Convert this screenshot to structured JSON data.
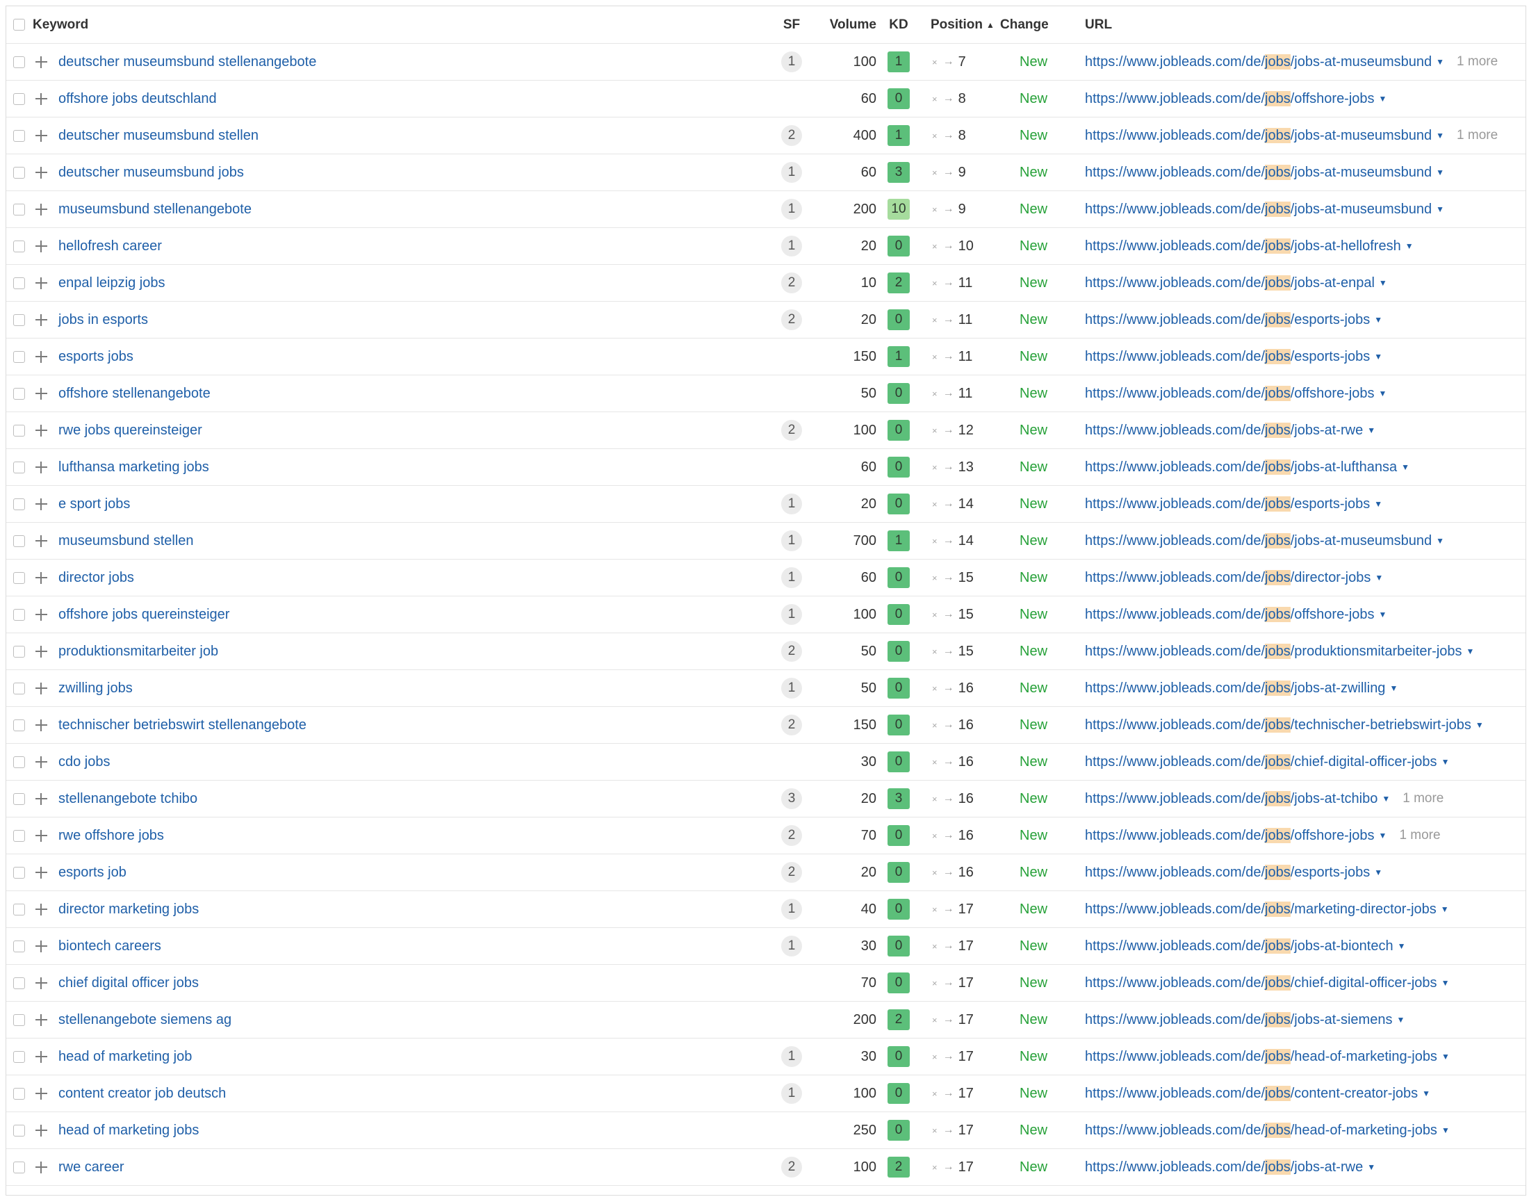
{
  "header": {
    "keyword": "Keyword",
    "sf": "SF",
    "volume": "Volume",
    "kd": "KD",
    "position": "Position",
    "change": "Change",
    "url": "URL"
  },
  "url_prefix": "https://www.jobleads.com/de/",
  "url_highlight": "jobs",
  "rows": [
    {
      "keyword": "deutscher museumsbund stellenangebote",
      "sf": "1",
      "volume": "100",
      "kd": "1",
      "position": "7",
      "change": "New",
      "url_slug": "jobs-at-museumsbund",
      "more": "1 more"
    },
    {
      "keyword": "offshore jobs deutschland",
      "sf": "",
      "volume": "60",
      "kd": "0",
      "position": "8",
      "change": "New",
      "url_slug": "offshore-jobs",
      "more": ""
    },
    {
      "keyword": "deutscher museumsbund stellen",
      "sf": "2",
      "volume": "400",
      "kd": "1",
      "position": "8",
      "change": "New",
      "url_slug": "jobs-at-museumsbund",
      "more": "1 more"
    },
    {
      "keyword": "deutscher museumsbund jobs",
      "sf": "1",
      "volume": "60",
      "kd": "3",
      "position": "9",
      "change": "New",
      "url_slug": "jobs-at-museumsbund",
      "more": ""
    },
    {
      "keyword": "museumsbund stellenangebote",
      "sf": "1",
      "volume": "200",
      "kd": "10",
      "position": "9",
      "change": "New",
      "url_slug": "jobs-at-museumsbund",
      "more": ""
    },
    {
      "keyword": "hellofresh career",
      "sf": "1",
      "volume": "20",
      "kd": "0",
      "position": "10",
      "change": "New",
      "url_slug": "jobs-at-hellofresh",
      "more": ""
    },
    {
      "keyword": "enpal leipzig jobs",
      "sf": "2",
      "volume": "10",
      "kd": "2",
      "position": "11",
      "change": "New",
      "url_slug": "jobs-at-enpal",
      "more": ""
    },
    {
      "keyword": "jobs in esports",
      "sf": "2",
      "volume": "20",
      "kd": "0",
      "position": "11",
      "change": "New",
      "url_slug": "esports-jobs",
      "more": ""
    },
    {
      "keyword": "esports jobs",
      "sf": "",
      "volume": "150",
      "kd": "1",
      "position": "11",
      "change": "New",
      "url_slug": "esports-jobs",
      "more": ""
    },
    {
      "keyword": "offshore stellenangebote",
      "sf": "",
      "volume": "50",
      "kd": "0",
      "position": "11",
      "change": "New",
      "url_slug": "offshore-jobs",
      "more": ""
    },
    {
      "keyword": "rwe jobs quereinsteiger",
      "sf": "2",
      "volume": "100",
      "kd": "0",
      "position": "12",
      "change": "New",
      "url_slug": "jobs-at-rwe",
      "more": ""
    },
    {
      "keyword": "lufthansa marketing jobs",
      "sf": "",
      "volume": "60",
      "kd": "0",
      "position": "13",
      "change": "New",
      "url_slug": "jobs-at-lufthansa",
      "more": ""
    },
    {
      "keyword": "e sport jobs",
      "sf": "1",
      "volume": "20",
      "kd": "0",
      "position": "14",
      "change": "New",
      "url_slug": "esports-jobs",
      "more": ""
    },
    {
      "keyword": "museumsbund stellen",
      "sf": "1",
      "volume": "700",
      "kd": "1",
      "position": "14",
      "change": "New",
      "url_slug": "jobs-at-museumsbund",
      "more": ""
    },
    {
      "keyword": "director jobs",
      "sf": "1",
      "volume": "60",
      "kd": "0",
      "position": "15",
      "change": "New",
      "url_slug": "director-jobs",
      "more": ""
    },
    {
      "keyword": "offshore jobs quereinsteiger",
      "sf": "1",
      "volume": "100",
      "kd": "0",
      "position": "15",
      "change": "New",
      "url_slug": "offshore-jobs",
      "more": ""
    },
    {
      "keyword": "produktionsmitarbeiter job",
      "sf": "2",
      "volume": "50",
      "kd": "0",
      "position": "15",
      "change": "New",
      "url_slug": "produktionsmitarbeiter-jobs",
      "more": ""
    },
    {
      "keyword": "zwilling jobs",
      "sf": "1",
      "volume": "50",
      "kd": "0",
      "position": "16",
      "change": "New",
      "url_slug": "jobs-at-zwilling",
      "more": ""
    },
    {
      "keyword": "technischer betriebswirt stellenangebote",
      "sf": "2",
      "volume": "150",
      "kd": "0",
      "position": "16",
      "change": "New",
      "url_slug": "technischer-betriebswirt-jobs",
      "more": ""
    },
    {
      "keyword": "cdo jobs",
      "sf": "",
      "volume": "30",
      "kd": "0",
      "position": "16",
      "change": "New",
      "url_slug": "chief-digital-officer-jobs",
      "more": ""
    },
    {
      "keyword": "stellenangebote tchibo",
      "sf": "3",
      "volume": "20",
      "kd": "3",
      "position": "16",
      "change": "New",
      "url_slug": "jobs-at-tchibo",
      "more": "1 more"
    },
    {
      "keyword": "rwe offshore jobs",
      "sf": "2",
      "volume": "70",
      "kd": "0",
      "position": "16",
      "change": "New",
      "url_slug": "offshore-jobs",
      "more": "1 more"
    },
    {
      "keyword": "esports job",
      "sf": "2",
      "volume": "20",
      "kd": "0",
      "position": "16",
      "change": "New",
      "url_slug": "esports-jobs",
      "more": ""
    },
    {
      "keyword": "director marketing jobs",
      "sf": "1",
      "volume": "40",
      "kd": "0",
      "position": "17",
      "change": "New",
      "url_slug": "marketing-director-jobs",
      "more": ""
    },
    {
      "keyword": "biontech careers",
      "sf": "1",
      "volume": "30",
      "kd": "0",
      "position": "17",
      "change": "New",
      "url_slug": "jobs-at-biontech",
      "more": ""
    },
    {
      "keyword": "chief digital officer jobs",
      "sf": "",
      "volume": "70",
      "kd": "0",
      "position": "17",
      "change": "New",
      "url_slug": "chief-digital-officer-jobs",
      "more": ""
    },
    {
      "keyword": "stellenangebote siemens ag",
      "sf": "",
      "volume": "200",
      "kd": "2",
      "position": "17",
      "change": "New",
      "url_slug": "jobs-at-siemens",
      "more": ""
    },
    {
      "keyword": "head of marketing job",
      "sf": "1",
      "volume": "30",
      "kd": "0",
      "position": "17",
      "change": "New",
      "url_slug": "head-of-marketing-jobs",
      "more": ""
    },
    {
      "keyword": "content creator job deutsch",
      "sf": "1",
      "volume": "100",
      "kd": "0",
      "position": "17",
      "change": "New",
      "url_slug": "content-creator-jobs",
      "more": ""
    },
    {
      "keyword": "head of marketing jobs",
      "sf": "",
      "volume": "250",
      "kd": "0",
      "position": "17",
      "change": "New",
      "url_slug": "head-of-marketing-jobs",
      "more": ""
    },
    {
      "keyword": "rwe career",
      "sf": "2",
      "volume": "100",
      "kd": "2",
      "position": "17",
      "change": "New",
      "url_slug": "jobs-at-rwe",
      "more": ""
    }
  ],
  "colors": {
    "link": "#1f5fa8",
    "change_new": "#27a139",
    "kd_low": "#5cbf7a",
    "kd_mid": "#a6dc9d",
    "url_highlight": "#f9d9ae"
  },
  "icons": {
    "row_add": "plus-icon",
    "url_dropdown": "caret-down-icon",
    "sort": "sort-asc-icon",
    "previous_position": "cross-icon",
    "position_change": "arrow-right-icon"
  }
}
